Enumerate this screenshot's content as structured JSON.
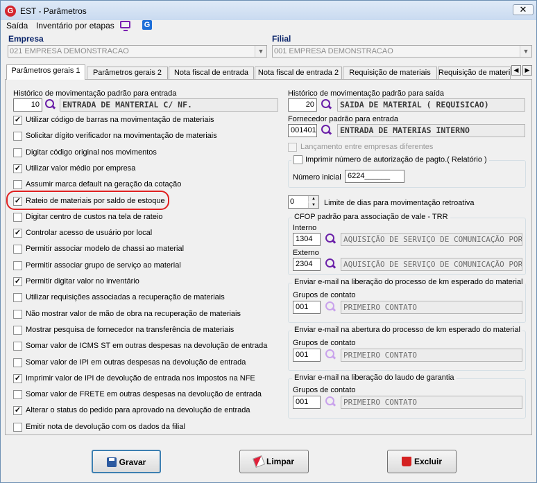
{
  "window": {
    "title": "EST - Parâmetros",
    "close_label": "✕",
    "app_icon_letter": "G"
  },
  "menu": {
    "items": [
      "Saída",
      "Inventário por etapas"
    ]
  },
  "empresa": {
    "label": "Empresa",
    "value": "021 EMPRESA DEMONSTRACAO"
  },
  "filial": {
    "label": "Filial",
    "value": "001 EMPRESA DEMONSTRACAO"
  },
  "tabs": [
    {
      "label": "Parâmetros gerais 1",
      "active": true
    },
    {
      "label": "Parâmetros gerais 2",
      "active": false
    },
    {
      "label": "Nota fiscal de entrada",
      "active": false
    },
    {
      "label": "Nota fiscal de entrada 2",
      "active": false
    },
    {
      "label": "Requisição de materiais",
      "active": false
    },
    {
      "label": "Requisição de materi",
      "active": false
    }
  ],
  "left": {
    "hist_entrada_label": "Histórico de movimentação padrão para entrada",
    "hist_entrada_code": "10",
    "hist_entrada_desc": "ENTRADA DE MANTERIAL C/ NF.",
    "checkboxes": [
      {
        "label": "Utilizar código de barras na movimentação de materiais",
        "checked": true
      },
      {
        "label": "Solicitar dígito verificador na movimentação de materiais",
        "checked": false
      },
      {
        "label": "Digitar código original nos movimentos",
        "checked": false
      },
      {
        "label": "Utilizar valor médio por empresa",
        "checked": true
      },
      {
        "label": "Assumir marca default na geração da cotação",
        "checked": false
      },
      {
        "label": "Rateio de materiais por saldo de estoque",
        "checked": true
      },
      {
        "label": "Digitar centro de custos na tela de rateio",
        "checked": false
      },
      {
        "label": "Controlar acesso de usuário por local",
        "checked": true
      },
      {
        "label": "Permitir associar modelo de chassi ao material",
        "checked": false
      },
      {
        "label": "Permitir associar grupo de serviço ao material",
        "checked": false
      },
      {
        "label": "Permitir digitar valor no inventário",
        "checked": true
      },
      {
        "label": "Utilizar requisições associadas a recuperação de materiais",
        "checked": false
      },
      {
        "label": "Não mostrar valor de mão de obra na recuperação de materiais",
        "checked": false
      },
      {
        "label": "Mostrar pesquisa de fornecedor na transferência de materiais",
        "checked": false
      },
      {
        "label": "Somar valor de ICMS ST em outras despesas na devolução de entrada",
        "checked": false
      },
      {
        "label": "Somar valor de IPI em outras despesas na devolução de entrada",
        "checked": false
      },
      {
        "label": "Imprimir valor de IPI de devolução de entrada nos impostos na NFE",
        "checked": true
      },
      {
        "label": "Somar valor de FRETE em outras despesas na devolução de entrada",
        "checked": false
      },
      {
        "label": "Alterar o status do pedido para aprovado na devolução de entrada",
        "checked": true
      },
      {
        "label": "Emitir nota de devolução com os dados da filial",
        "checked": false
      }
    ]
  },
  "right": {
    "hist_saida_label": "Histórico de movimentação padrão para saída",
    "hist_saida_code": "20",
    "hist_saida_desc": "SAIDA DE MATERIAL ( REQUISICAO)",
    "forn_label": "Fornecedor padrão para entrada",
    "forn_code": "001401",
    "forn_desc": "ENTRADA DE MATERIAS  INTERNO",
    "lanc_label": "Lançamento entre empresas diferentes",
    "imprimir_label": "Imprimir número de autorização de pagto.( Relatório )",
    "numero_inicial_label": "Número inicial",
    "numero_inicial_value": "6224______",
    "limite_value": "0",
    "limite_label": "Limite de dias para movimentação retroativa",
    "cfop_legend": "CFOP padrão para associação de vale - TRR",
    "interno_label": "Interno",
    "interno_code": "1304",
    "interno_desc": "AQUISIÇÃO DE SERVIÇO DE COMUNICAÇÃO POR I",
    "externo_label": "Externo",
    "externo_code": "2304",
    "externo_desc": "AQUISIÇÃO DE SERVIÇO DE COMUNICAÇÃO POR I",
    "email1_legend": "Enviar e-mail na liberação do processo de km esperado do material",
    "email2_legend": "Enviar e-mail na abertura do processo de km esperado do material",
    "email3_legend": "Enviar e-mail na liberação do laudo de garantia",
    "grupos_label": "Grupos de contato",
    "grupo_code": "001",
    "grupo_desc": "PRIMEIRO CONTATO"
  },
  "buttons": {
    "gravar": "Gravar",
    "limpar": "Limpar",
    "excluir": "Excluir"
  }
}
